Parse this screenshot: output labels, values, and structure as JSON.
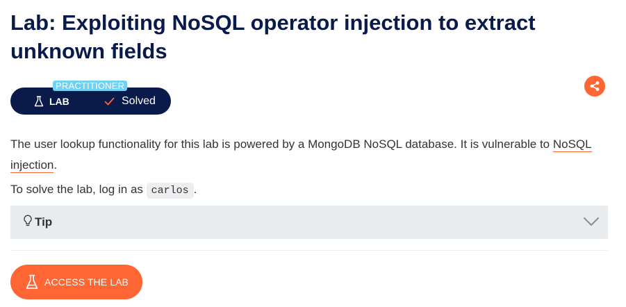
{
  "title": "Lab: Exploiting NoSQL operator injection to extract unknown fields",
  "badge": {
    "level": "PRACTITIONER",
    "type_label": "LAB",
    "status": "Solved",
    "icons": [
      "flask-icon",
      "check-icon"
    ]
  },
  "share": {
    "icon": "share-icon"
  },
  "description": {
    "text": "The user lookup functionality for this lab is powered by a MongoDB NoSQL database. It is vulnerable to ",
    "link_text": "NoSQL injection",
    "end": "."
  },
  "solve": {
    "prefix": "To solve the lab, log in as ",
    "username": "carlos",
    "suffix": "."
  },
  "tip": {
    "label": "Tip",
    "icons": [
      "lightbulb-icon",
      "chevron-down-icon"
    ]
  },
  "access_button": {
    "label": "ACCESS THE LAB",
    "icon": "flask-icon"
  },
  "colors": {
    "title": "#0a1a4a",
    "badge_bg": "#0a1a4a",
    "level_tag": "#70d1f4",
    "accent": "#ff6633",
    "tip_bg": "#e8ecef",
    "text": "#333332"
  }
}
